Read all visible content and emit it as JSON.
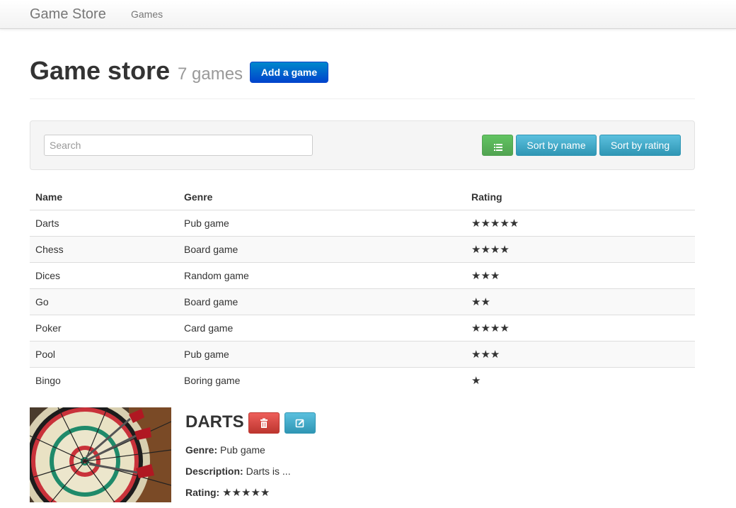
{
  "navbar": {
    "brand": "Game Store",
    "links": [
      "Games"
    ]
  },
  "header": {
    "title": "Game store",
    "count": "7 games",
    "add_label": "Add a game"
  },
  "toolbar": {
    "search_placeholder": "Search",
    "list_icon": "list-icon",
    "sort_name_label": "Sort by name",
    "sort_rating_label": "Sort by rating"
  },
  "table": {
    "headers": [
      "Name",
      "Genre",
      "Rating"
    ],
    "rows": [
      {
        "name": "Darts",
        "genre": "Pub game",
        "rating": "★★★★★"
      },
      {
        "name": "Chess",
        "genre": "Board game",
        "rating": "★★★★"
      },
      {
        "name": "Dices",
        "genre": "Random game",
        "rating": "★★★"
      },
      {
        "name": "Go",
        "genre": "Board game",
        "rating": "★★"
      },
      {
        "name": "Poker",
        "genre": "Card game",
        "rating": "★★★★"
      },
      {
        "name": "Pool",
        "genre": "Pub game",
        "rating": "★★★"
      },
      {
        "name": "Bingo",
        "genre": "Boring game",
        "rating": "★"
      }
    ]
  },
  "detail": {
    "name": "DARTS",
    "genre_label": "Genre:",
    "genre": "Pub game",
    "description_label": "Description:",
    "description": "Darts is ...",
    "rating_label": "Rating:",
    "rating": "★★★★★"
  },
  "colors": {
    "primary": "#0044cc",
    "success": "#51a351",
    "info": "#2f96b4",
    "danger": "#bd362f"
  }
}
